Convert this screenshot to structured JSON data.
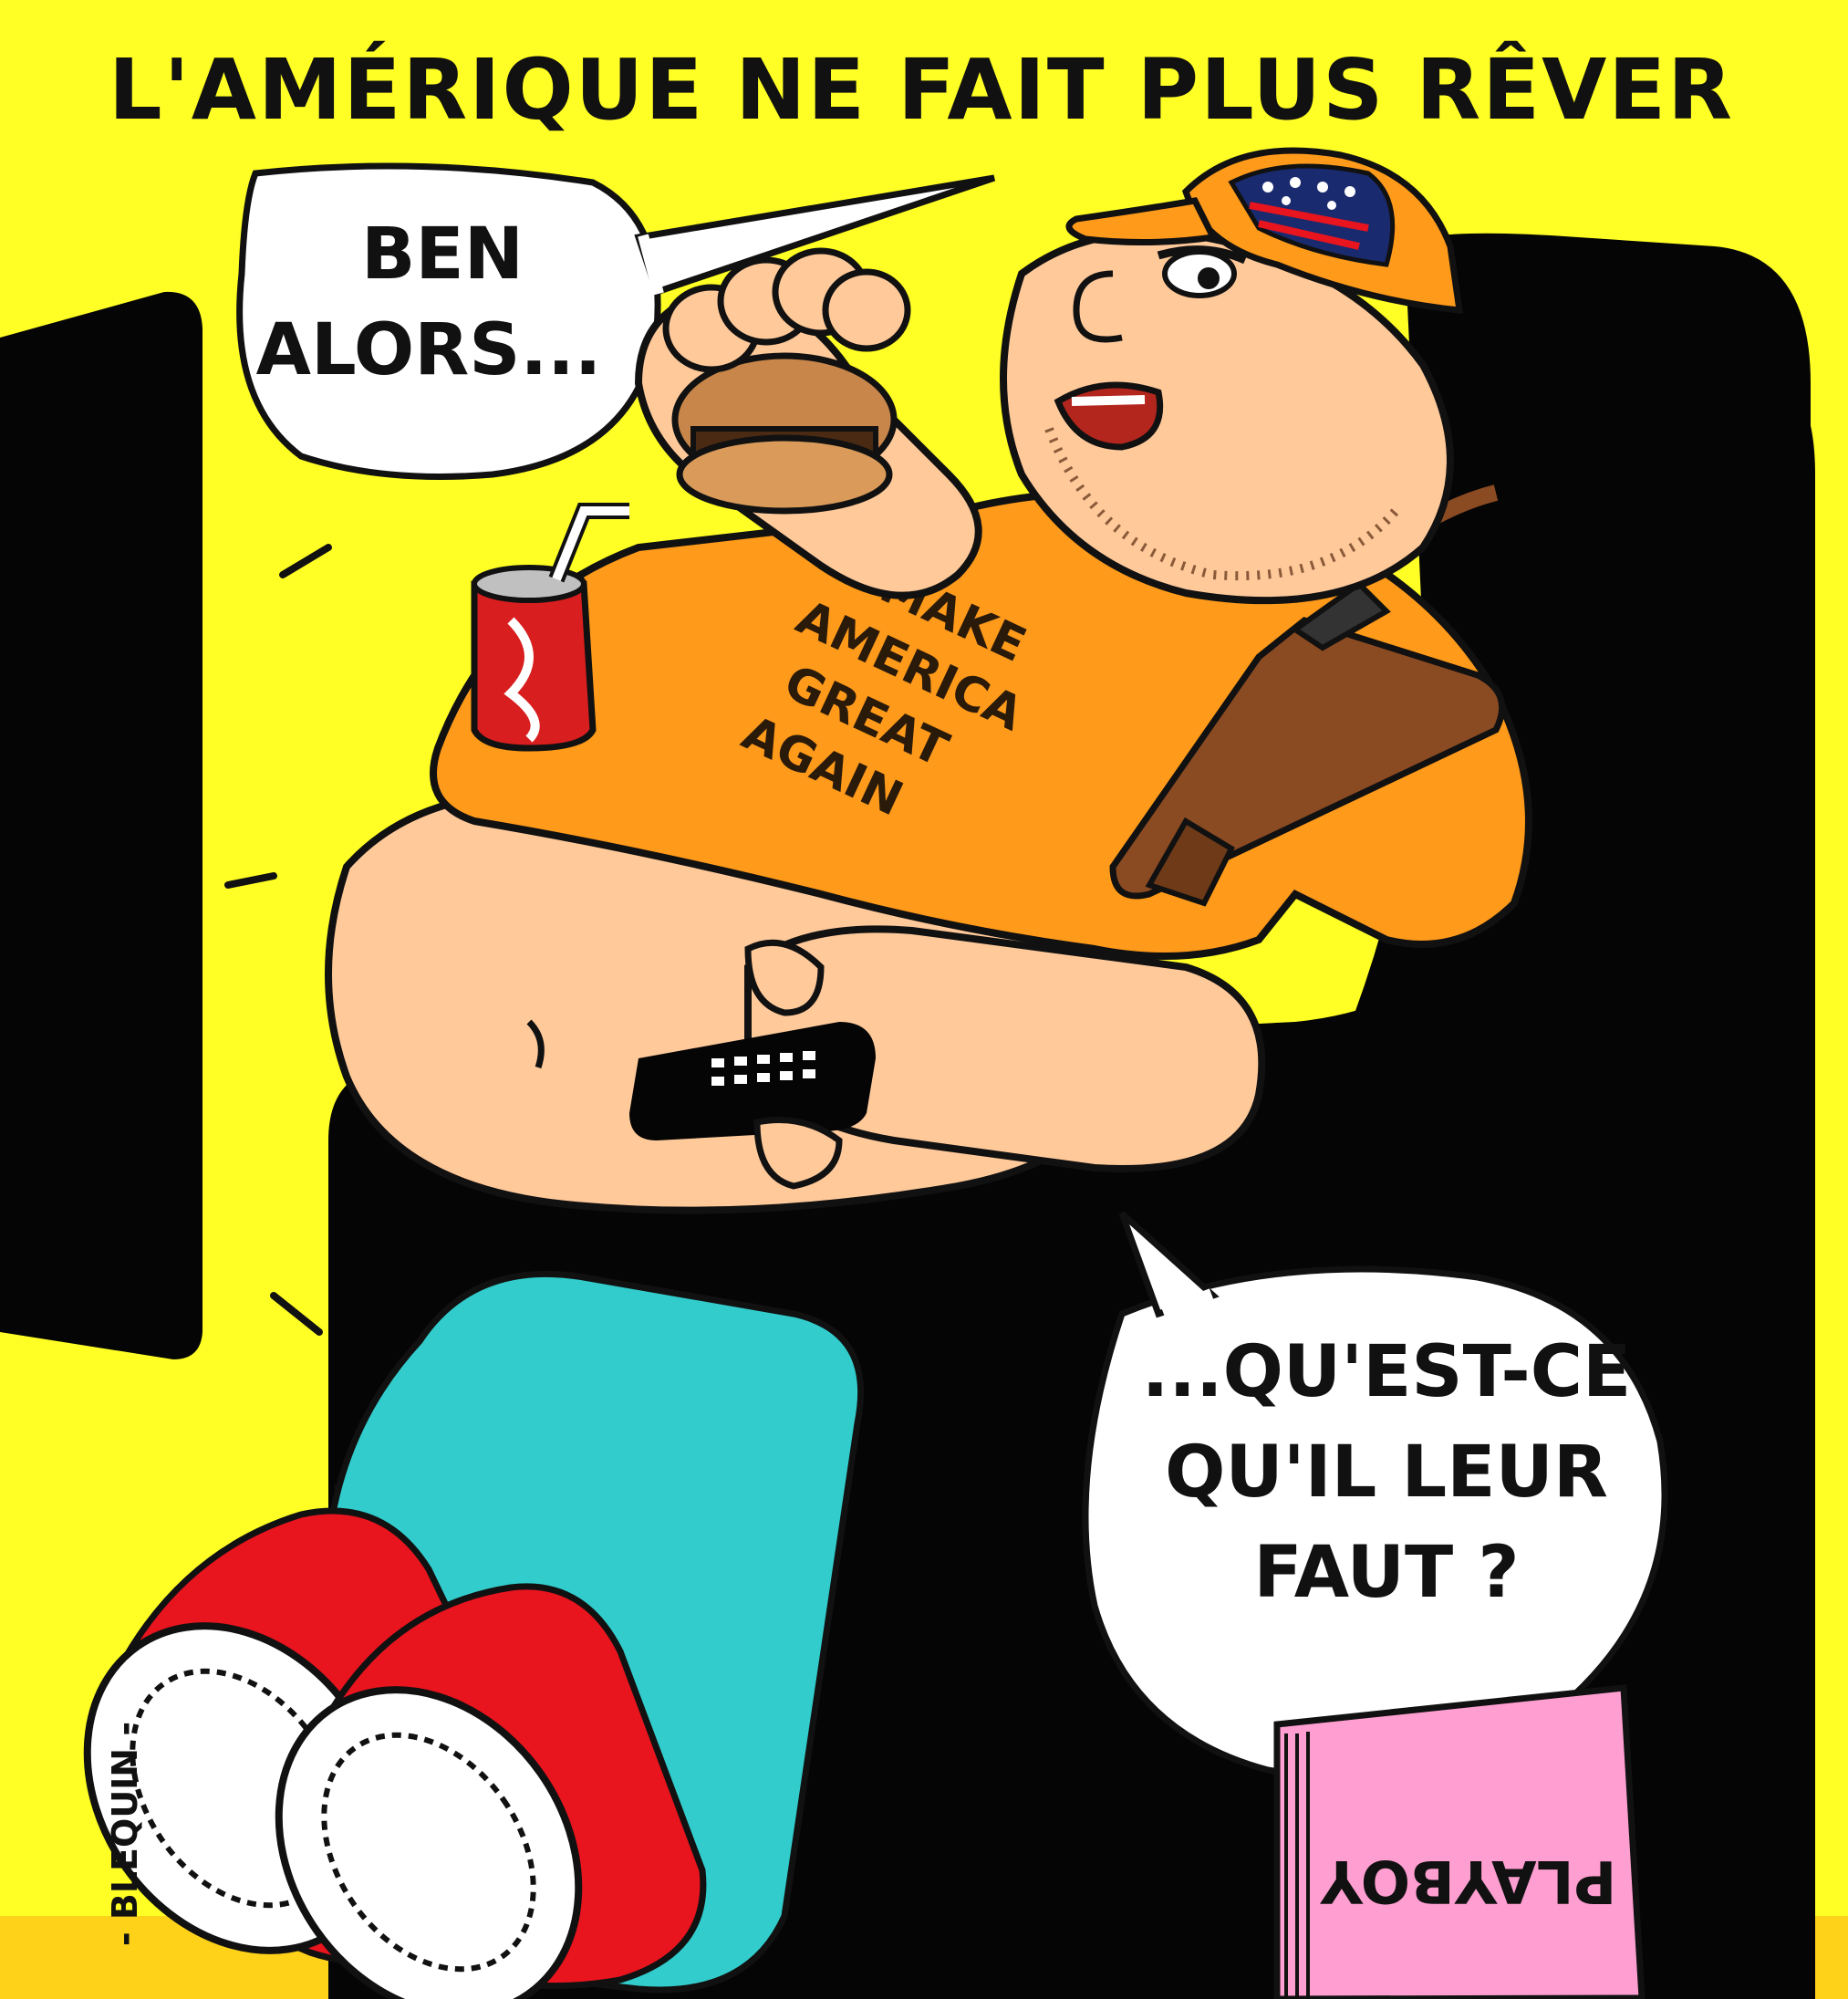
{
  "title": "L'AMÉRIQUE NE FAIT PLUS RÊVER",
  "bubble_top": {
    "line1": "BEN",
    "line2": "ALORS..."
  },
  "bubble_bottom": {
    "line1": "...QU'EST-CE",
    "line2": "QU'IL LEUR",
    "line3": "FAUT ?"
  },
  "shirt": {
    "line1": "MAKE",
    "line2": "AMERICA",
    "line3": "GREAT",
    "line4": "AGAIN"
  },
  "magazine_label": "PLAYBOY",
  "signature": "- BLEQUIN -",
  "colors": {
    "background": "#ffff26",
    "armchair": "#050505",
    "skin": "#ffc99a",
    "shirt": "#ff9a1a",
    "jeans": "#33cccc",
    "sneakers": "#e8141e",
    "cap": "#ff9a1a",
    "magazine": "#ff9fd1",
    "rifle": "#8a4a22",
    "can": "#d81e1e",
    "floor": "#ffd21a"
  }
}
